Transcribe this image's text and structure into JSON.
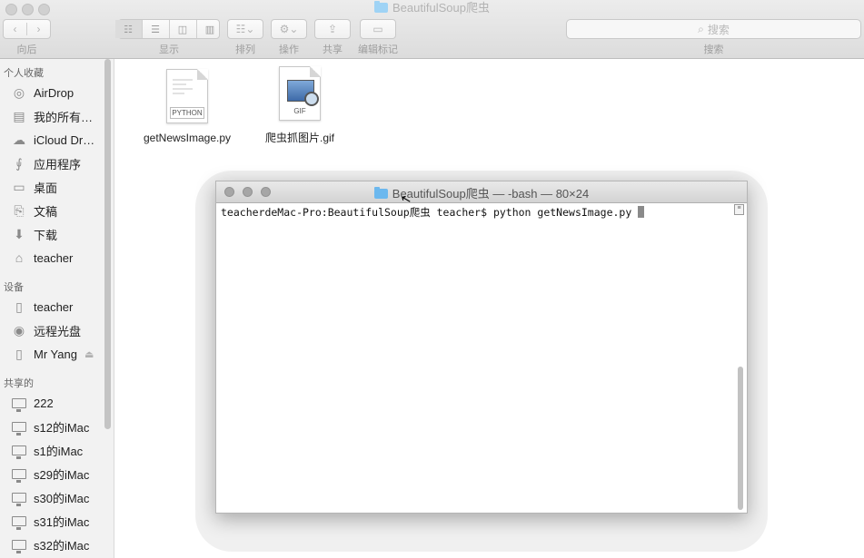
{
  "finder": {
    "title": "BeautifulSoup爬虫",
    "toolbar": {
      "back_label": "向后",
      "view_label": "显示",
      "arrange_label": "排列",
      "action_label": "操作",
      "share_label": "共享",
      "tags_label": "编辑标记",
      "search_label": "搜索",
      "search_placeholder": "搜索"
    }
  },
  "sidebar": {
    "favorites_header": "个人收藏",
    "favorites": [
      {
        "label": "AirDrop",
        "icon": "airdrop-icon"
      },
      {
        "label": "我的所有…",
        "icon": "all-files-icon"
      },
      {
        "label": "iCloud Dr…",
        "icon": "cloud-icon"
      },
      {
        "label": "应用程序",
        "icon": "applications-icon"
      },
      {
        "label": "桌面",
        "icon": "desktop-icon"
      },
      {
        "label": "文稿",
        "icon": "documents-icon"
      },
      {
        "label": "下载",
        "icon": "download-icon"
      },
      {
        "label": "teacher",
        "icon": "home-icon"
      }
    ],
    "devices_header": "设备",
    "devices": [
      {
        "label": "teacher",
        "icon": "disk-icon"
      },
      {
        "label": "远程光盘",
        "icon": "optical-disc-icon"
      },
      {
        "label": "Mr Yang",
        "icon": "drive-icon"
      }
    ],
    "shared_header": "共享的",
    "shared": [
      {
        "label": "222",
        "icon": "computer-icon"
      },
      {
        "label": "s12的iMac",
        "icon": "computer-icon"
      },
      {
        "label": "s1的iMac",
        "icon": "computer-icon"
      },
      {
        "label": "s29的iMac",
        "icon": "computer-icon"
      },
      {
        "label": "s30的iMac",
        "icon": "computer-icon"
      },
      {
        "label": "s31的iMac",
        "icon": "computer-icon"
      },
      {
        "label": "s32的iMac",
        "icon": "computer-icon"
      }
    ]
  },
  "files": [
    {
      "name": "getNewsImage.py",
      "badge": "PYTHON"
    },
    {
      "name": "爬虫抓图片.gif",
      "badge": "GIF"
    }
  ],
  "terminal": {
    "title": "BeautifulSoup爬虫 — -bash — 80×24",
    "prompt_line": "teacherdeMac-Pro:BeautifulSoup爬虫 teacher$ python getNewsImage.py "
  }
}
